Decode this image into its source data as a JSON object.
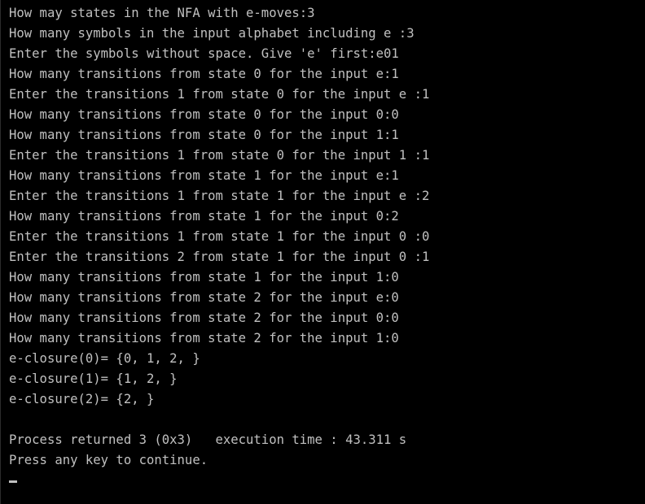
{
  "console": {
    "lines": [
      "How may states in the NFA with e-moves:3",
      "How many symbols in the input alphabet including e :3",
      "Enter the symbols without space. Give 'e' first:e01",
      "How many transitions from state 0 for the input e:1",
      "Enter the transitions 1 from state 0 for the input e :1",
      "How many transitions from state 0 for the input 0:0",
      "How many transitions from state 0 for the input 1:1",
      "Enter the transitions 1 from state 0 for the input 1 :1",
      "How many transitions from state 1 for the input e:1",
      "Enter the transitions 1 from state 1 for the input e :2",
      "How many transitions from state 1 for the input 0:2",
      "Enter the transitions 1 from state 1 for the input 0 :0",
      "Enter the transitions 2 from state 1 for the input 0 :1",
      "How many transitions from state 1 for the input 1:0",
      "How many transitions from state 2 for the input e:0",
      "How many transitions from state 2 for the input 0:0",
      "How many transitions from state 2 for the input 1:0",
      "e-closure(0)= {0, 1, 2, }",
      "e-closure(1)= {1, 2, }",
      "e-closure(2)= {2, }"
    ],
    "process_returned": "Process returned 3 (0x3)   execution time : 43.311 s",
    "press_key": "Press any key to continue."
  },
  "colors": {
    "background": "#000000",
    "text": "#c0c0c0"
  }
}
